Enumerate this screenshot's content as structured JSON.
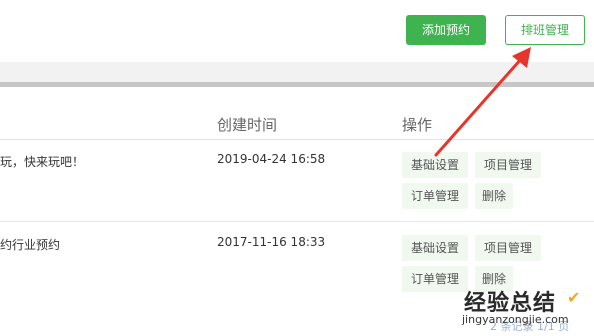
{
  "toolbar": {
    "add_label": "添加预约",
    "schedule_label": "排班管理"
  },
  "table": {
    "headers": {
      "created": "创建时间",
      "actions": "操作"
    },
    "rows": [
      {
        "name": "玩，快来玩吧！",
        "created": "2019-04-24 16:58",
        "actions": [
          "基础设置",
          "项目管理",
          "订单管理",
          "删除"
        ]
      },
      {
        "name": "约行业预约",
        "created": "2017-11-16 18:33",
        "actions": [
          "基础设置",
          "项目管理",
          "订单管理",
          "删除"
        ]
      }
    ]
  },
  "pager": {
    "text": "2 条记录 1/1 页"
  },
  "watermark": {
    "title": "经验总结",
    "subtitle": "jingyanzongjie.com"
  },
  "colors": {
    "accent_green": "#3fb34f",
    "arrow_red": "#e8352b",
    "op_bg": "#f0f8f0"
  },
  "icons": {
    "arrow": "red-arrow-icon",
    "watermark_check": "check-icon"
  }
}
